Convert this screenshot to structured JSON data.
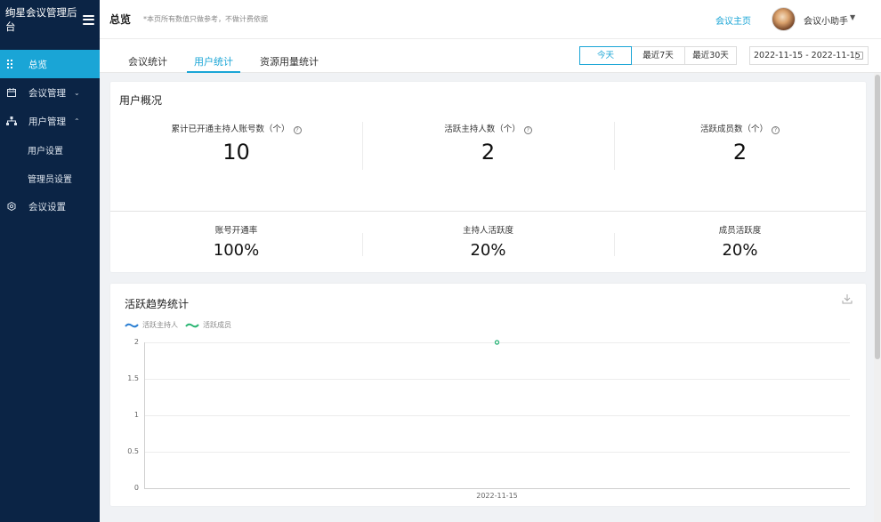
{
  "sidebar": {
    "app_title": "绚星会议管理后台",
    "items": [
      {
        "label": "总览",
        "icon": "grid-icon",
        "active": true
      },
      {
        "label": "会议管理",
        "icon": "calendar-icon",
        "arrow": "⌄"
      },
      {
        "label": "用户管理",
        "icon": "org-chart-icon",
        "arrow": "⌃"
      },
      {
        "label": "用户设置",
        "sub": true
      },
      {
        "label": "管理员设置",
        "sub": true
      },
      {
        "label": "会议设置",
        "icon": "settings-icon"
      }
    ]
  },
  "header": {
    "page_title": "总览",
    "note": "*本页所有数值只做参考，不做计费依据",
    "home_link": "会议主页",
    "user_name": "会议小助手"
  },
  "tabs": [
    {
      "label": "会议统计"
    },
    {
      "label": "用户统计",
      "active": true
    },
    {
      "label": "资源用量统计"
    }
  ],
  "range_buttons": [
    {
      "label": "今天",
      "active": true
    },
    {
      "label": "最近7天"
    },
    {
      "label": "最近30天"
    }
  ],
  "date_range": "2022-11-15 - 2022-11-15",
  "overview": {
    "title": "用户概况",
    "stats": [
      {
        "label": "累计已开通主持人账号数（个）",
        "value": "10"
      },
      {
        "label": "活跃主持人数（个）",
        "value": "2"
      },
      {
        "label": "活跃成员数（个）",
        "value": "2"
      }
    ],
    "rates": [
      {
        "label": "账号开通率",
        "value": "100%"
      },
      {
        "label": "主持人活跃度",
        "value": "20%"
      },
      {
        "label": "成员活跃度",
        "value": "20%"
      }
    ]
  },
  "trend": {
    "title": "活跃趋势统计",
    "download_icon": "download-icon"
  },
  "chart_data": {
    "type": "line",
    "x": [
      "2022-11-15"
    ],
    "series": [
      {
        "name": "活跃主持人",
        "values": [
          2
        ],
        "color": "#2b7fd3"
      },
      {
        "name": "活跃成员",
        "values": [
          2
        ],
        "color": "#2bb673"
      }
    ],
    "y_ticks": [
      "2",
      "1.5",
      "1",
      "0.5",
      "0"
    ],
    "ylim": [
      0,
      2
    ],
    "grid": true,
    "legend": "top-left"
  }
}
